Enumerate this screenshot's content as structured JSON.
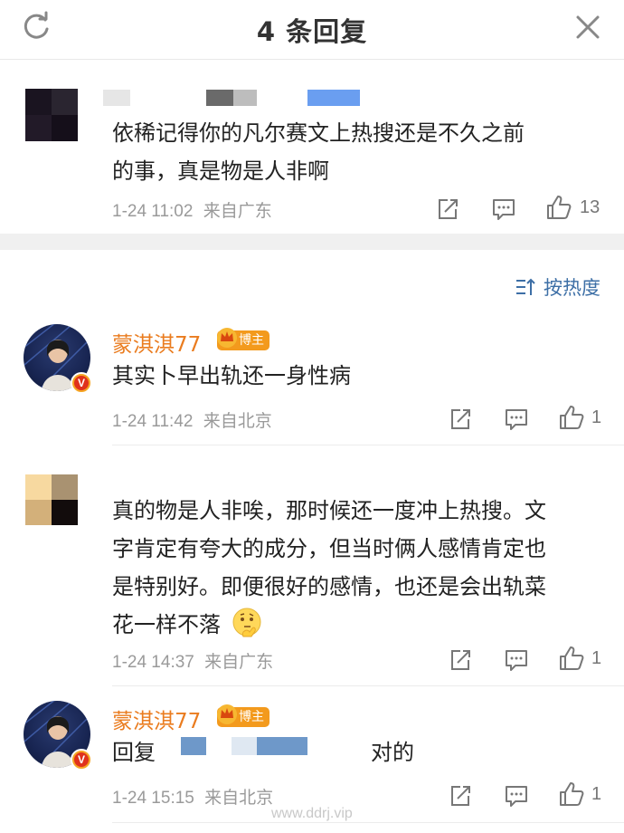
{
  "header": {
    "title": "4 条回复",
    "refresh_icon": "refresh-icon",
    "close_icon": "close-icon"
  },
  "root_comment": {
    "text_line1": "依稀记得你的凡尔赛文上热搜还是不久之前",
    "text_line2": "的事，真是物是人非啊",
    "time": "1-24 11:02",
    "location": "来自广东",
    "likes": "13"
  },
  "sort": {
    "label": "按热度",
    "icon": "sort-icon"
  },
  "replies": [
    {
      "username": "蒙淇淇77",
      "badge": "博主",
      "text": "其实卜早出轨还一身性病",
      "time": "1-24 11:42",
      "location": "来自北京",
      "likes": "1"
    },
    {
      "text_line1": "真的物是人非唉，那时候还一度冲上热搜。文",
      "text_line2": "字肯定有夸大的成分，但当时俩人感情肯定也",
      "text_line3": "是特别好。即便很好的感情，也还是会出轨菜",
      "text_line4": "花一样不落",
      "emoji": "thinking-emoji",
      "time": "1-24 14:37",
      "location": "来自广东",
      "likes": "1"
    },
    {
      "username": "蒙淇淇77",
      "badge": "博主",
      "reply_prefix": "回复",
      "text": "对的",
      "time": "1-24 15:15",
      "location": "来自北京",
      "likes": "1"
    }
  ],
  "watermark": "www.ddrj.vip",
  "colors": {
    "accent_orange": "#ea7c1f",
    "link_blue": "#3d6fa6",
    "meta_gray": "#9a9a9a"
  }
}
